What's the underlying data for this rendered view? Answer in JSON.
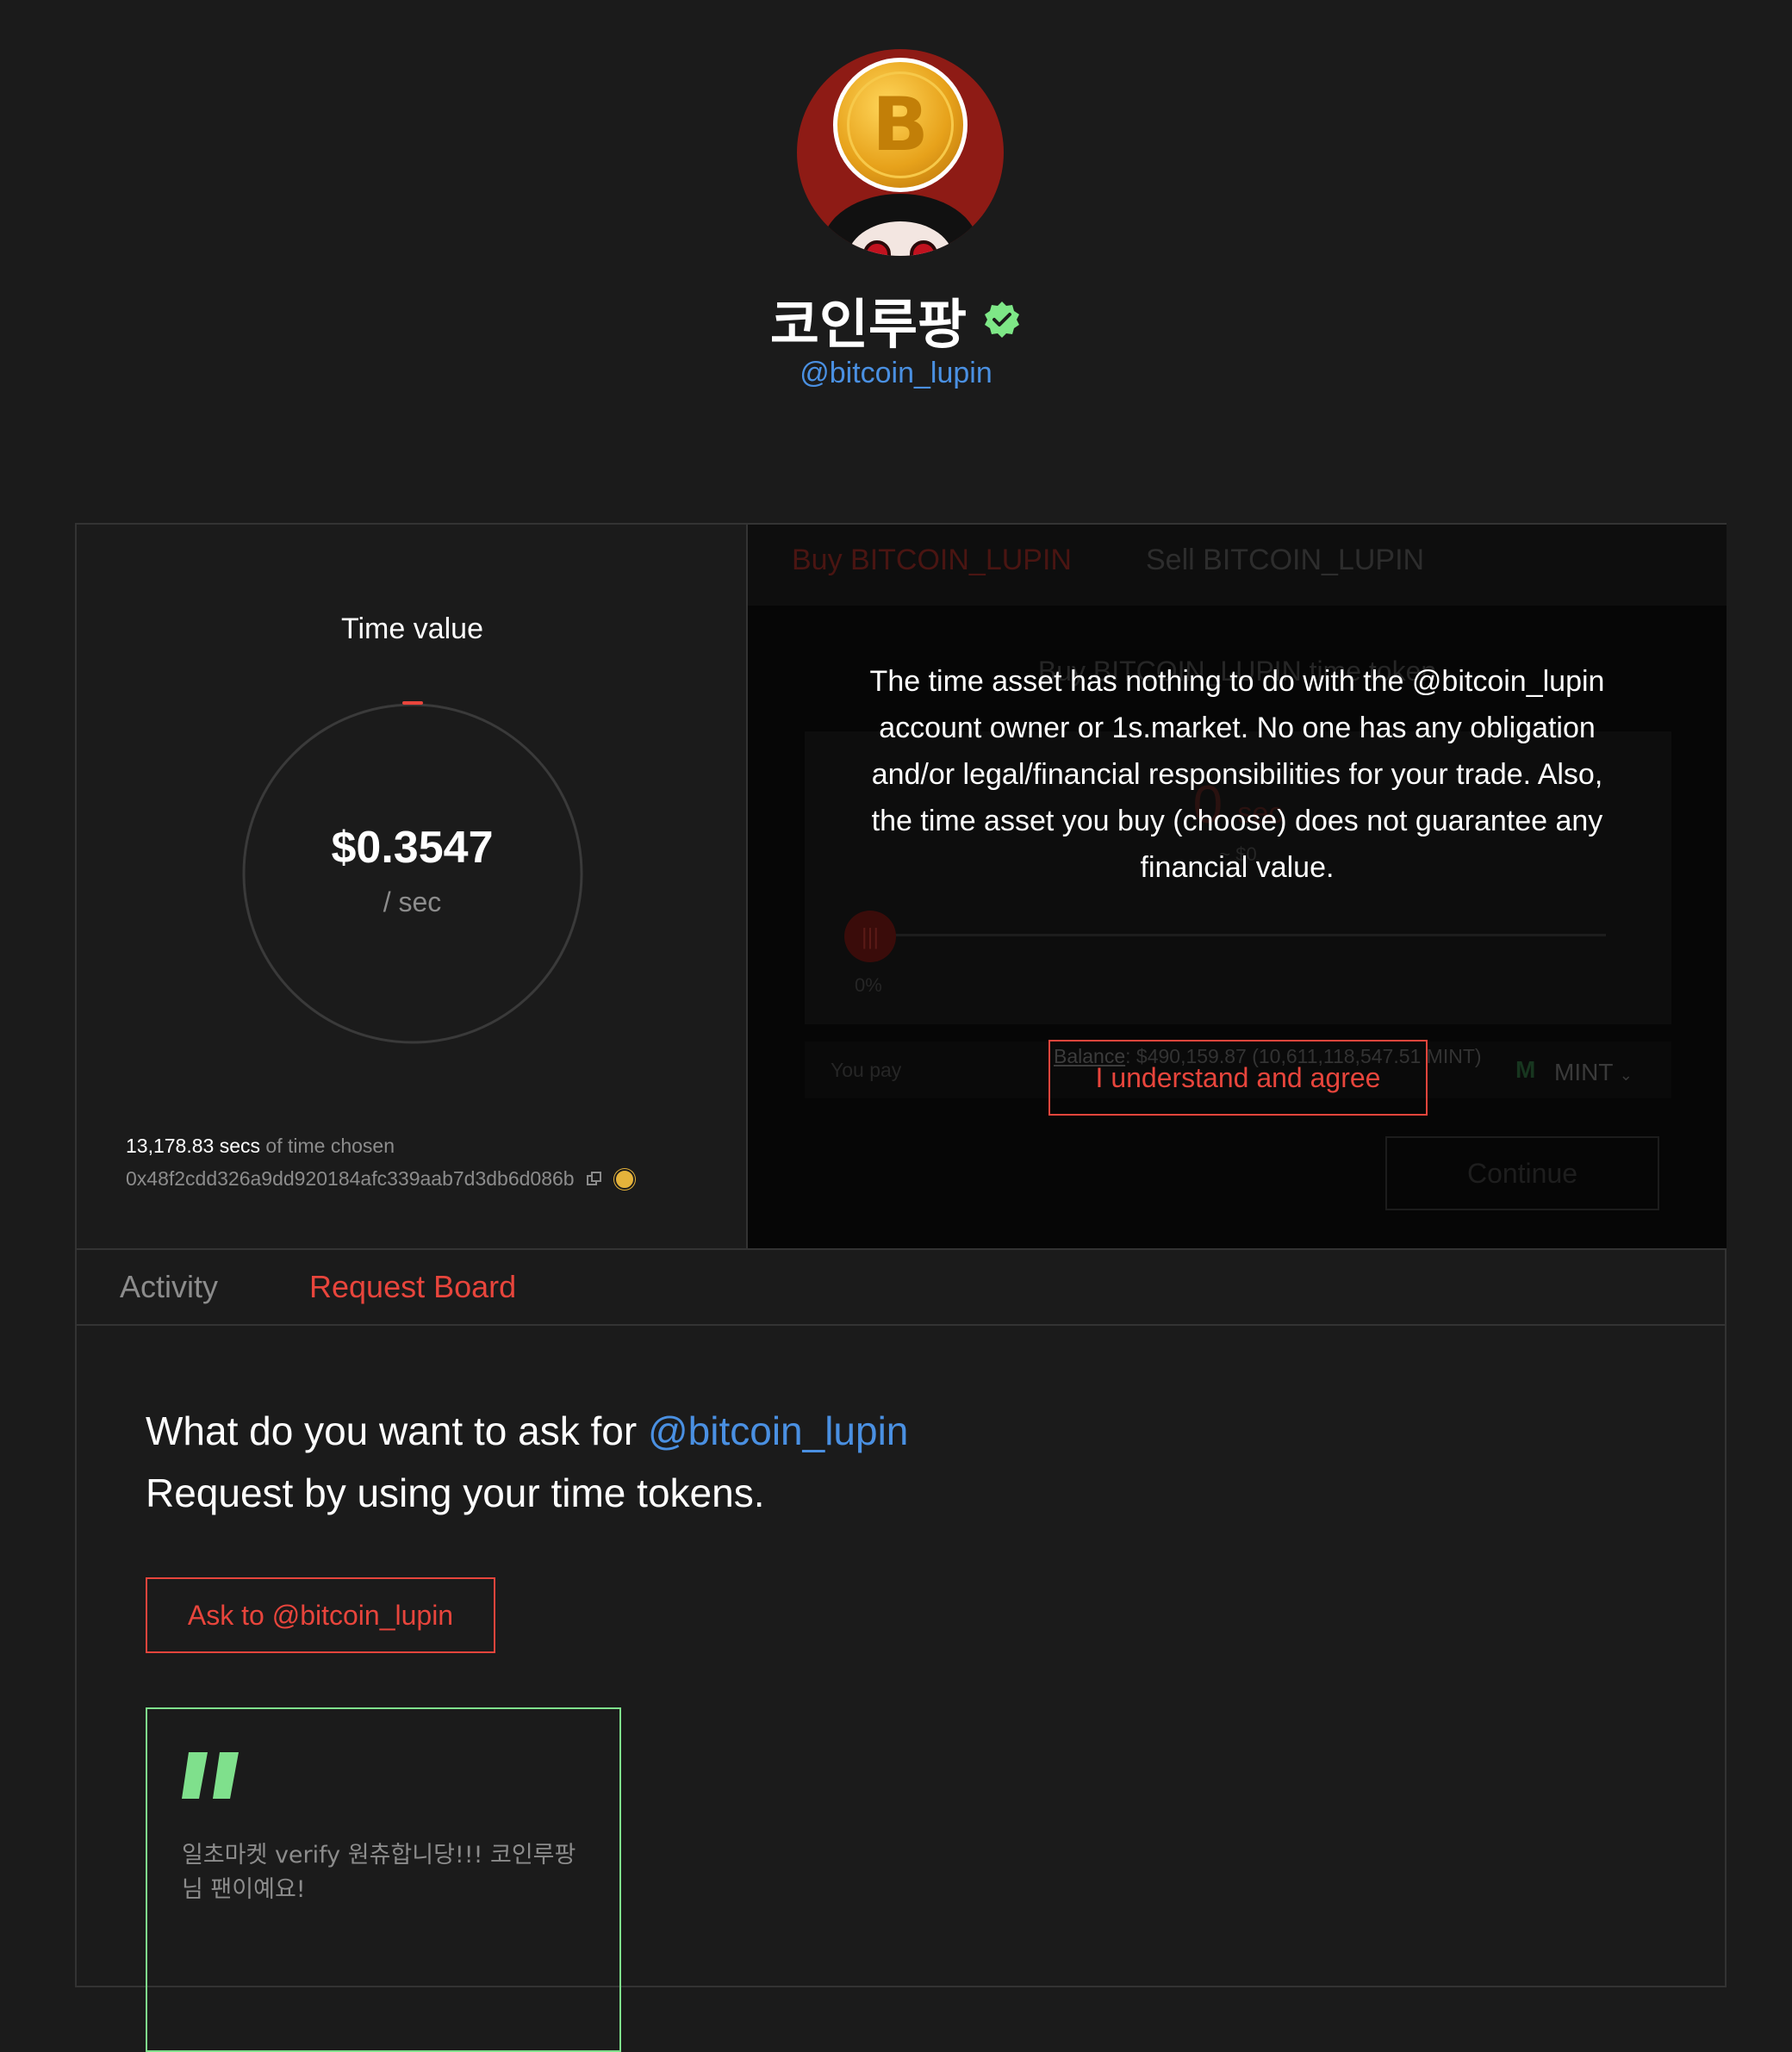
{
  "profile": {
    "display_name": "코인루팡",
    "handle": "@bitcoin_lupin",
    "verified_icon": "verified-badge-icon",
    "verified_color": "#7ee787",
    "avatar_bg": "#8e1b15",
    "coin_symbol": "B"
  },
  "time_card": {
    "title": "Time value",
    "price": "$0.3547",
    "unit": "/ sec",
    "secs_value": "13,178.83 secs",
    "secs_suffix": "of time chosen",
    "address": "0x48f2cdd326a9dd920184afc339aab7d3db6d086b",
    "copy_icon": "copy-icon",
    "explorer_icon": "explorer-icon",
    "gauge_progress": 0.0
  },
  "trade": {
    "tab_buy": "Buy BITCOIN_LUPIN",
    "tab_sell": "Sell BITCOIN_LUPIN",
    "subtitle": "Buy BITCOIN_LUPIN time token",
    "amount": "0",
    "amount_unit": "sec",
    "approx": "~ $0",
    "slider_icon": "slider-handle-icon",
    "slider_percent": "0%",
    "you_pay_label": "You pay",
    "balance_label": "Balance",
    "balance_value": ": $490,159.87 (10,611,118,547.51 MINT)",
    "currency": "MINT",
    "currency_icon": "mint-logo-icon",
    "continue_label": "Continue"
  },
  "disclaimer": {
    "text": "The time asset has nothing to do with the @bitcoin_lupin account owner or 1s.market. No one has any obligation and/or legal/financial responsibilities for your trade. Also, the time asset you buy (choose) does not guarantee any financial value.",
    "agree_label": "I understand and agree"
  },
  "tabs": {
    "activity": "Activity",
    "request_board": "Request Board"
  },
  "request_board": {
    "ask_prefix": "What do you want to ask for",
    "ask_mention": "@bitcoin_lupin",
    "ask_line2": "Request by using your time tokens.",
    "ask_button": "Ask to @bitcoin_lupin",
    "quote_icon": "quote-icon",
    "quote_text": "일초마켓 verify 원츄합니당!!! 코인루팡님 팬이예요!"
  },
  "colors": {
    "background": "#1b1b1b",
    "accent_red": "#e8453c",
    "link_blue": "#4a90e2",
    "quote_green": "#7fe08c"
  }
}
